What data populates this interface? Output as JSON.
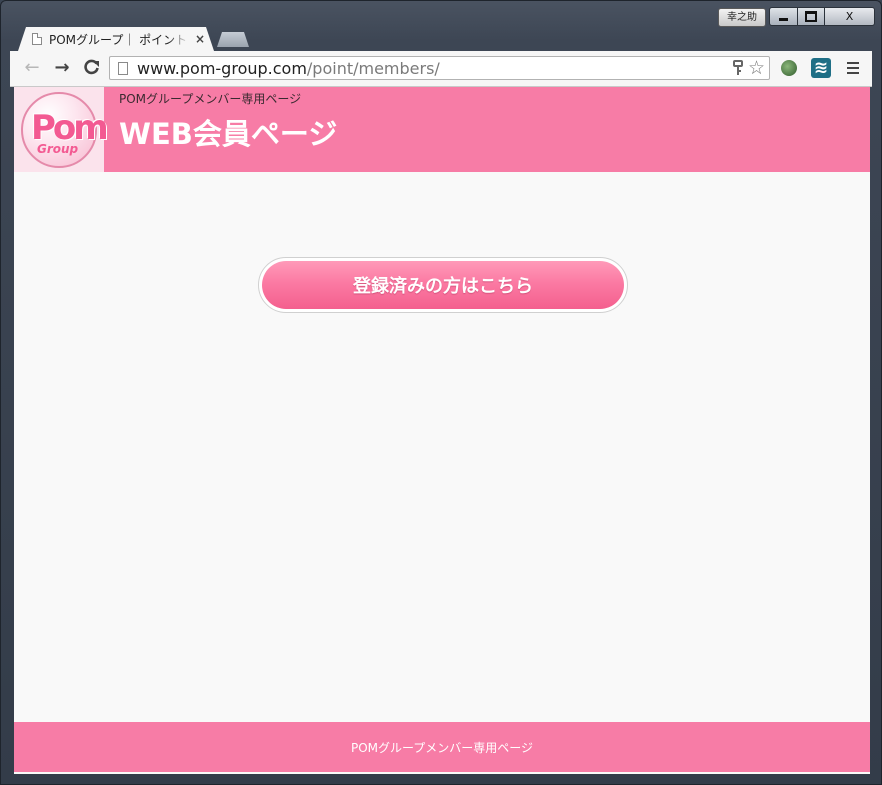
{
  "window": {
    "user_badge": "幸之助",
    "minimize": "minimize",
    "maximize": "maximize",
    "close_label": "X"
  },
  "tabs": [
    {
      "title": "POMグループ｜ ポイント",
      "close": "×"
    }
  ],
  "toolbar": {
    "back": "←",
    "forward": "→",
    "reload": "C",
    "url_host": "www.pom-group.com",
    "url_path": "/point/members/",
    "key_icon": "key-icon",
    "star": "☆",
    "ext_icons": [
      "globe-extension-icon",
      "wave-extension-icon"
    ],
    "menu": "menu-icon"
  },
  "site": {
    "logo_text": "Pom",
    "logo_sub": "Group",
    "header_sub": "POMグループメンバー専用ページ",
    "header_title": "WEB会員ページ",
    "login_button": "登録済みの方はこちら",
    "footer_text": "POMグループメンバー専用ページ"
  },
  "colors": {
    "brand_pink": "#f77ca6",
    "button_pink": "#f45f8e",
    "page_bg": "#f9f9f9"
  }
}
